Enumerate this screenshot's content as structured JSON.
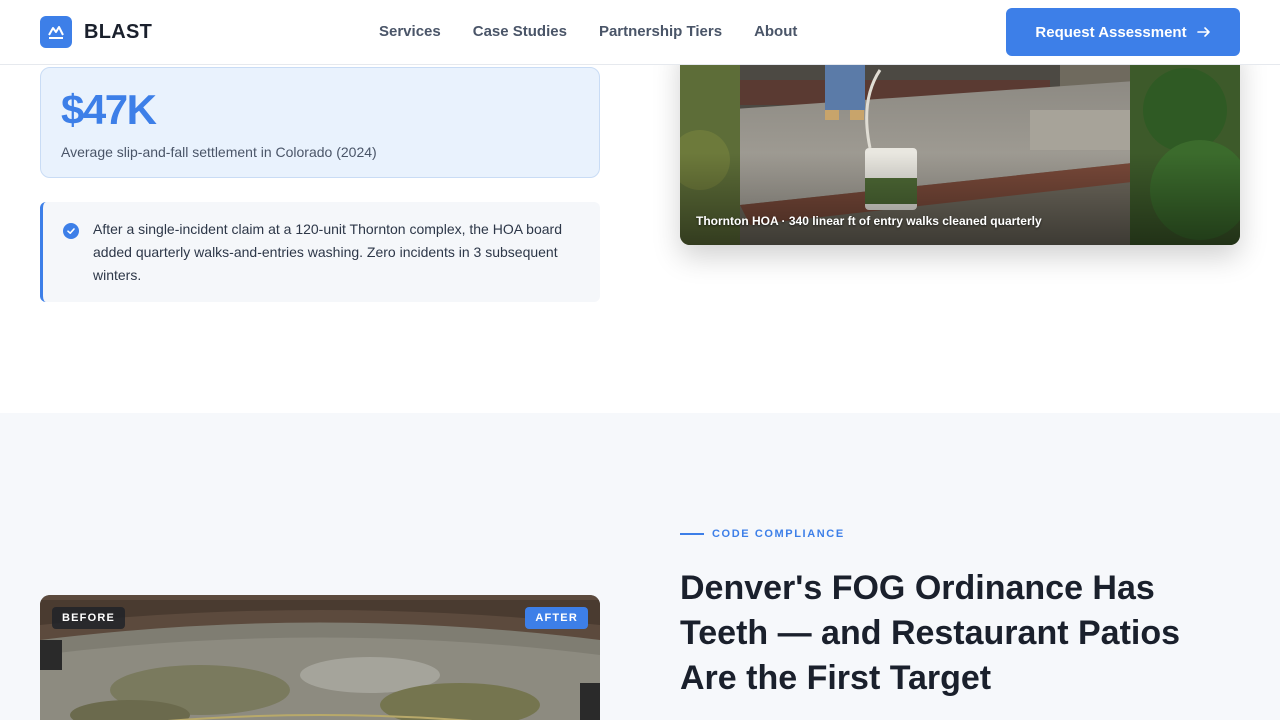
{
  "header": {
    "brand": "BLAST",
    "nav": [
      "Services",
      "Case Studies",
      "Partnership Tiers",
      "About"
    ],
    "cta_label": "Request Assessment"
  },
  "stat": {
    "value": "$47K",
    "label": "Average slip-and-fall settlement in Colorado (2024)"
  },
  "callout": {
    "text": "After a single-incident claim at a 120-unit Thornton complex, the HOA board added quarterly walks-and-entries washing. Zero incidents in 3 subsequent winters."
  },
  "photo1": {
    "caption": "Thornton HOA · 340 linear ft of entry walks cleaned quarterly"
  },
  "compliance": {
    "eyebrow": "CODE COMPLIANCE",
    "headline": "Denver's FOG Ordinance Has Teeth — and Restaurant Patios Are the First Target"
  },
  "photo2": {
    "before_label": "BEFORE",
    "after_label": "AFTER"
  },
  "colors": {
    "accent": "#3d7fe8",
    "text": "#1a202c",
    "muted": "#4a5568"
  }
}
